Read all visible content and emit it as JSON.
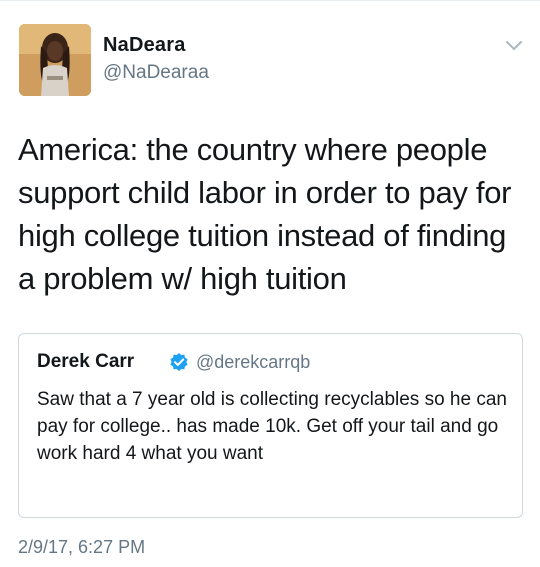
{
  "author": {
    "name": "NaDeara",
    "handle": "@NaDearaa",
    "avatar_icon": "profile-photo"
  },
  "tweet": {
    "text": "America: the country where people support child labor in order to pay for high college tuition instead of finding a problem w/ high tuition",
    "timestamp": "2/9/17, 6:27 PM"
  },
  "quoted_tweet": {
    "name": "Derek Carr",
    "verified": true,
    "handle": "@derekcarrqb",
    "text": "Saw that a 7 year old is collecting recyclables so he can pay for college.. has made 10k. Get off your tail and go work hard 4 what you want"
  },
  "icons": {
    "menu": "chevron-down-icon",
    "verified": "verified-badge-icon"
  },
  "colors": {
    "primary_text": "#14171a",
    "secondary_text": "#657786",
    "verified_blue": "#1da1f2",
    "border": "#cfd9de"
  }
}
